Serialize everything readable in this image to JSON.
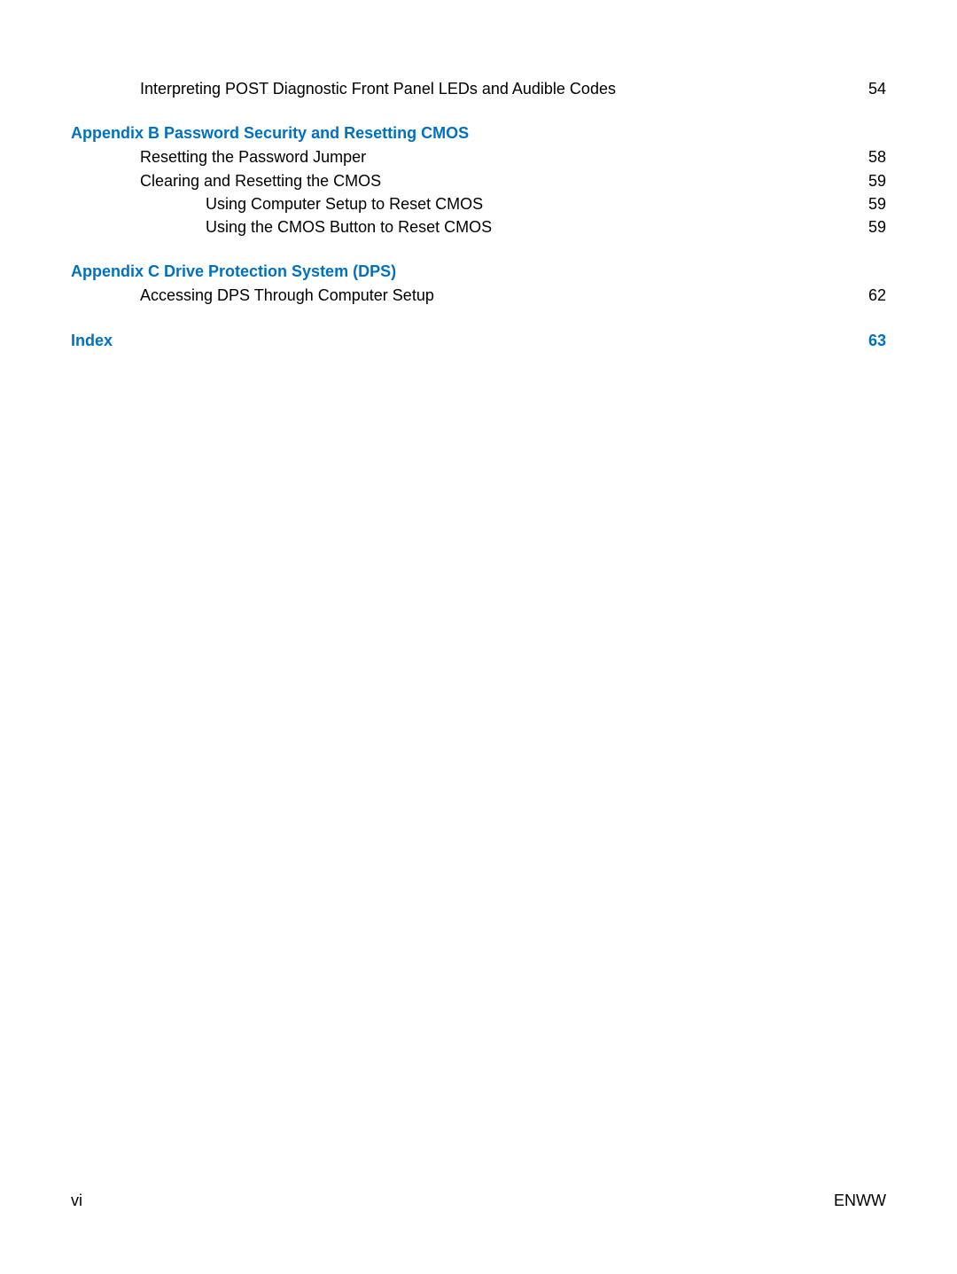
{
  "orphan_entry": {
    "text": "Interpreting POST Diagnostic Front Panel LEDs and Audible Codes",
    "page": "54"
  },
  "appendix_b": {
    "heading": "Appendix B  Password Security and Resetting CMOS",
    "entries": [
      {
        "text": "Resetting the Password Jumper",
        "page": "58",
        "indent": 2
      },
      {
        "text": "Clearing and Resetting the CMOS",
        "page": "59",
        "indent": 2
      },
      {
        "text": "Using Computer Setup to Reset CMOS",
        "page": "59",
        "indent": 3
      },
      {
        "text": "Using the CMOS Button to Reset CMOS",
        "page": "59",
        "indent": 3
      }
    ]
  },
  "appendix_c": {
    "heading": "Appendix C  Drive Protection System (DPS)",
    "entries": [
      {
        "text": "Accessing DPS Through Computer Setup",
        "page": "62",
        "indent": 2
      }
    ]
  },
  "index": {
    "label": "Index",
    "page": "63"
  },
  "footer": {
    "left": "vi",
    "right": "ENWW"
  }
}
